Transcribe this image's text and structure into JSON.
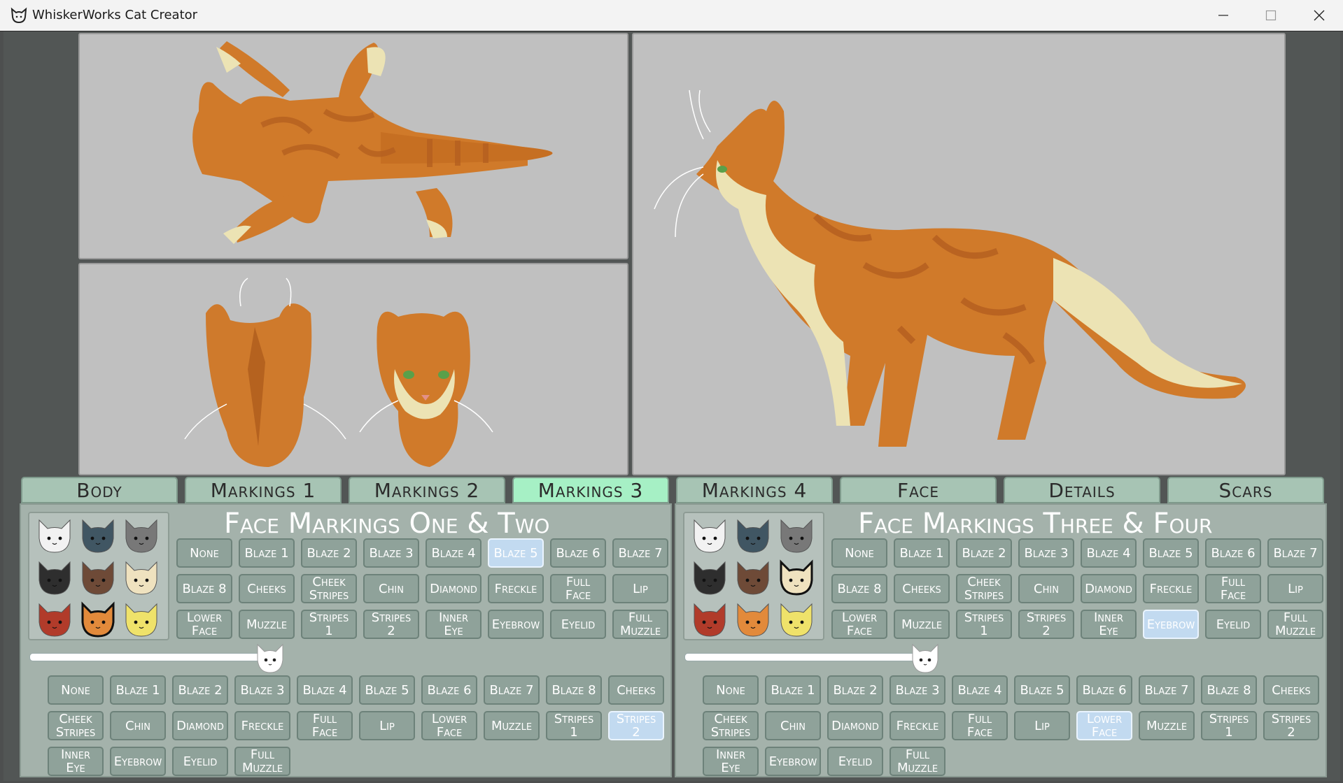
{
  "window": {
    "title": "WhiskerWorks Cat Creator",
    "icon": "cat-icon"
  },
  "tabs": [
    {
      "label": "Body"
    },
    {
      "label": "Markings 1"
    },
    {
      "label": "Markings 2"
    },
    {
      "label": "Markings 3",
      "active": true
    },
    {
      "label": "Markings 4"
    },
    {
      "label": "Face"
    },
    {
      "label": "Details"
    },
    {
      "label": "Scars"
    }
  ],
  "left_panel": {
    "title": "Face Markings One & Two",
    "swatch_colors": [
      "#f2f2f2",
      "#405663",
      "#787878",
      "#2e2e2e",
      "#6e4a37",
      "#efe2bf",
      "#b13b2a",
      "#e28a3b",
      "#efe26a"
    ],
    "selected_swatch": 7,
    "slider_value": 0.86,
    "grid1": [
      "None",
      "Blaze 1",
      "Blaze 2",
      "Blaze 3",
      "Blaze 4",
      "Blaze 5",
      "Blaze 6",
      "Blaze 7",
      "Blaze 8",
      "Cheeks",
      "Cheek\nStripes",
      "Chin",
      "Diamond",
      "Freckle",
      "Full\nFace",
      "Lip",
      "Lower\nFace",
      "Muzzle",
      "Stripes\n1",
      "Stripes\n2",
      "Inner\nEye",
      "Eyebrow",
      "Eyelid",
      "Full\nMuzzle"
    ],
    "grid1_selected": "Blaze 5",
    "grid2": [
      "None",
      "Blaze 1",
      "Blaze 2",
      "Blaze 3",
      "Blaze 4",
      "Blaze 5",
      "Blaze 6",
      "Blaze 7",
      "Blaze 8",
      "Cheeks",
      "Cheek\nStripes",
      "Chin",
      "Diamond",
      "Freckle",
      "Full\nFace",
      "Lip",
      "Lower\nFace",
      "Muzzle",
      "Stripes\n1",
      "Stripes\n2",
      "Inner\nEye",
      "Eyebrow",
      "Eyelid",
      "Full\nMuzzle"
    ],
    "grid2_selected": "Stripes\n2"
  },
  "right_panel": {
    "title": "Face Markings Three & Four",
    "swatch_colors": [
      "#f2f2f2",
      "#405663",
      "#787878",
      "#2e2e2e",
      "#6e4a37",
      "#efe2bf",
      "#b13b2a",
      "#e28a3b",
      "#efe26a"
    ],
    "selected_swatch": 5,
    "slider_value": 0.86,
    "grid1": [
      "None",
      "Blaze 1",
      "Blaze 2",
      "Blaze 3",
      "Blaze 4",
      "Blaze 5",
      "Blaze 6",
      "Blaze 7",
      "Blaze 8",
      "Cheeks",
      "Cheek\nStripes",
      "Chin",
      "Diamond",
      "Freckle",
      "Full\nFace",
      "Lip",
      "Lower\nFace",
      "Muzzle",
      "Stripes\n1",
      "Stripes\n2",
      "Inner\nEye",
      "Eyebrow",
      "Eyelid",
      "Full\nMuzzle"
    ],
    "grid1_selected": "Eyebrow",
    "grid2": [
      "None",
      "Blaze 1",
      "Blaze 2",
      "Blaze 3",
      "Blaze 4",
      "Blaze 5",
      "Blaze 6",
      "Blaze 7",
      "Blaze 8",
      "Cheeks",
      "Cheek\nStripes",
      "Chin",
      "Diamond",
      "Freckle",
      "Full\nFace",
      "Lip",
      "Lower\nFace",
      "Muzzle",
      "Stripes\n1",
      "Stripes\n2",
      "Inner\nEye",
      "Eyebrow",
      "Eyelid",
      "Full\nMuzzle"
    ],
    "grid2_selected": "Lower\nFace"
  },
  "previews": {
    "top": "cat-pelt-top-view",
    "front_back": "cat-head-front-back-view",
    "side": "cat-side-view"
  }
}
